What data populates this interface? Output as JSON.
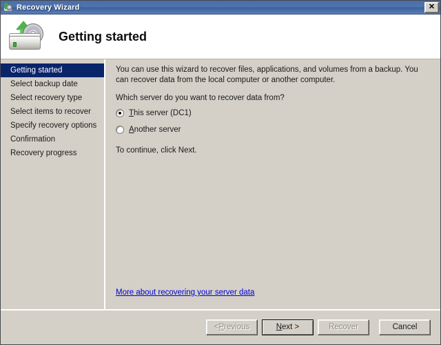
{
  "window": {
    "title": "Recovery Wizard",
    "icon": "recovery-drive-icon",
    "close_label": "✕"
  },
  "header": {
    "title": "Getting started",
    "icon": "recovery-drive-icon"
  },
  "sidebar": {
    "items": [
      {
        "label": "Getting started",
        "selected": true
      },
      {
        "label": "Select backup date",
        "selected": false
      },
      {
        "label": "Select recovery type",
        "selected": false
      },
      {
        "label": "Select items to recover",
        "selected": false
      },
      {
        "label": "Specify recovery options",
        "selected": false
      },
      {
        "label": "Confirmation",
        "selected": false
      },
      {
        "label": "Recovery progress",
        "selected": false
      }
    ]
  },
  "content": {
    "intro": "You can use this wizard to recover files, applications, and volumes from a backup. You can recover data from the local computer or another computer.",
    "question": "Which server do you want to recover data from?",
    "options": [
      {
        "label_prefix": "",
        "accel": "T",
        "label_rest": "his server (DC1)",
        "checked": true
      },
      {
        "label_prefix": "",
        "accel": "A",
        "label_rest": "nother server",
        "checked": false
      }
    ],
    "continue_text": "To continue, click Next.",
    "more_link": "More about recovering your server data"
  },
  "buttons": {
    "previous": {
      "prefix": "< ",
      "accel": "P",
      "rest": "revious",
      "disabled": true
    },
    "next": {
      "prefix": "",
      "accel": "N",
      "rest": "ext >",
      "disabled": false,
      "default": true
    },
    "recover": {
      "label": "Recover",
      "disabled": true
    },
    "cancel": {
      "label": "Cancel",
      "disabled": false
    }
  },
  "colors": {
    "titlebar_blue": "#4a6ea9",
    "selection_blue": "#0a246a",
    "dialog_face": "#d4d0c8",
    "link_blue": "#0000d4",
    "accent_green": "#3faa3f"
  }
}
